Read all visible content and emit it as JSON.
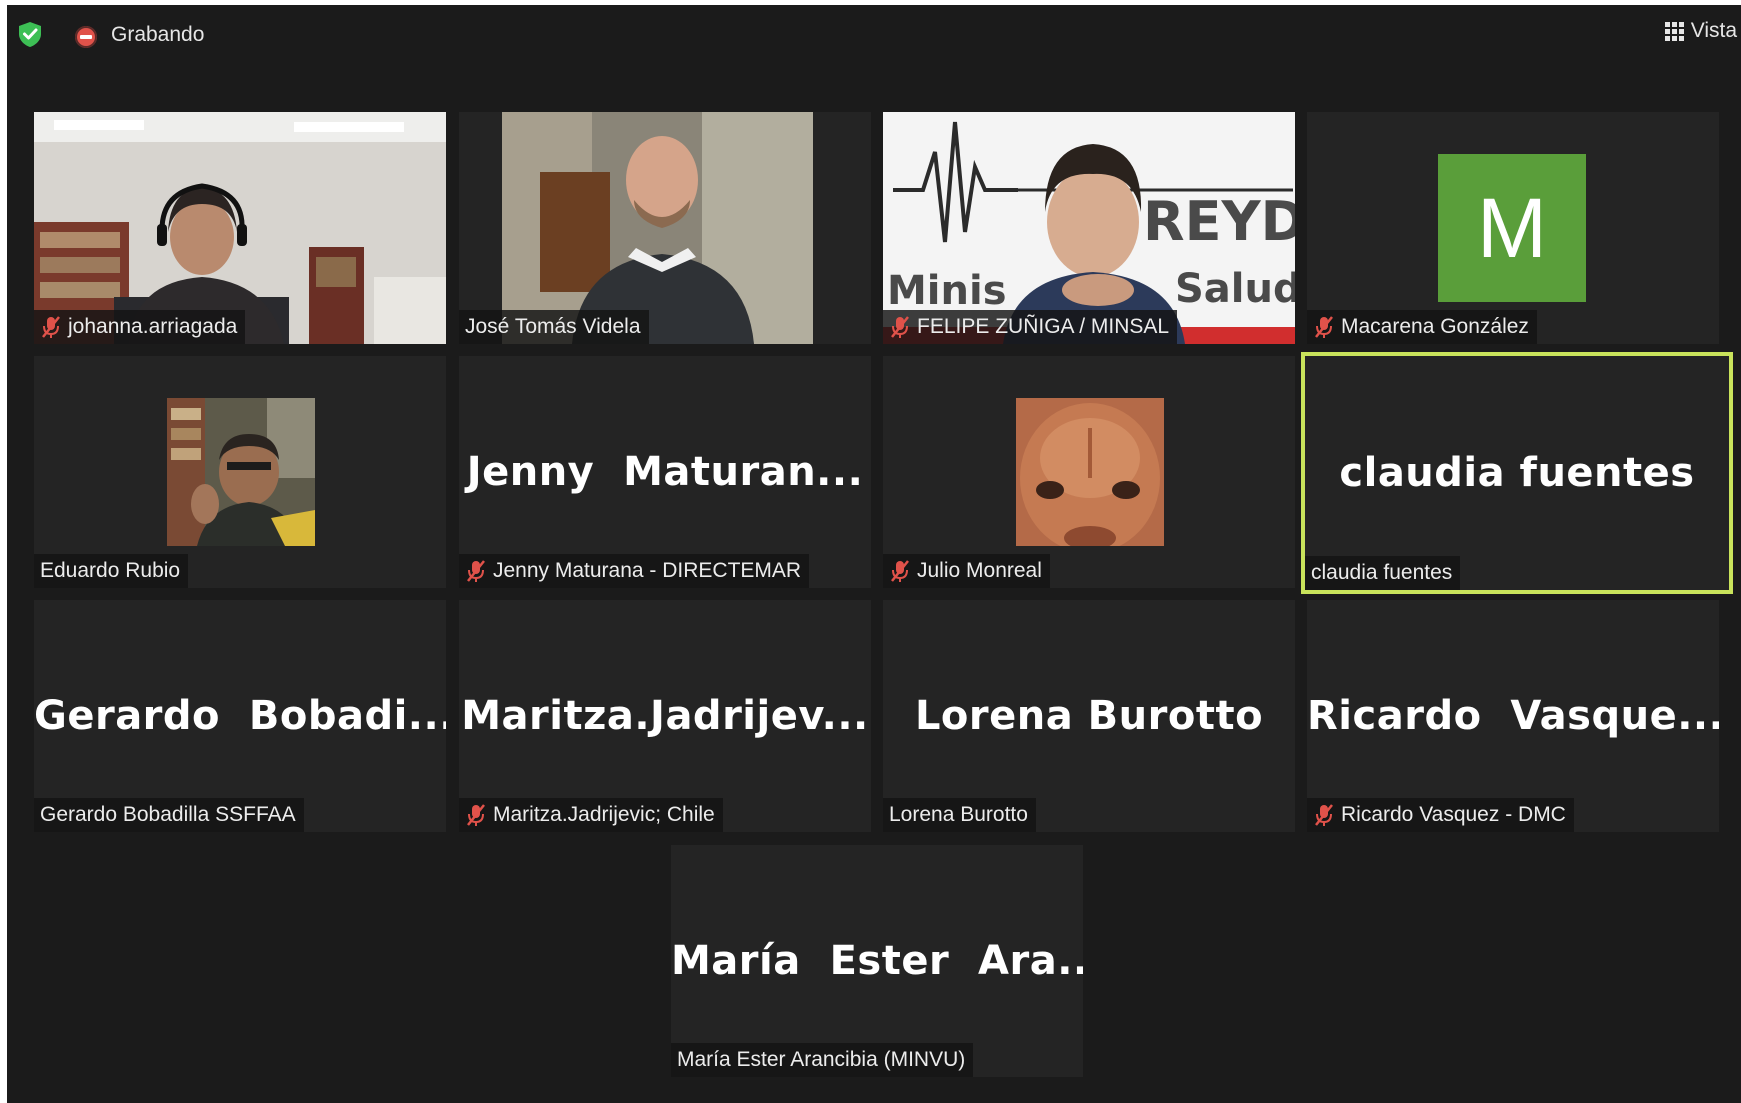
{
  "topbar": {
    "recording_label": "Grabando",
    "view_label": "Vista",
    "icons": [
      "shield-check-icon",
      "recording-icon",
      "grid-view-icon"
    ]
  },
  "colors": {
    "background": "#1b1b1b",
    "tile": "#242424",
    "active_speaker_border": "#c9e35b",
    "muted_mic": "#e0524a",
    "avatar": "#5a9e3a",
    "security_shield": "#3dbf55"
  },
  "participants": [
    {
      "display_name": "johanna.arriagada",
      "big_label": "",
      "muted": true,
      "video": true
    },
    {
      "display_name": "José Tomás Videla",
      "big_label": "",
      "muted": false,
      "video": true
    },
    {
      "display_name": "FELIPE ZUÑIGA / MINSAL",
      "big_label": "",
      "muted": true,
      "video": true
    },
    {
      "display_name": "Macarena González",
      "big_label": "M",
      "muted": true,
      "video": false
    },
    {
      "display_name": "Eduardo Rubio",
      "big_label": "",
      "muted": false,
      "video": true
    },
    {
      "display_name": "Jenny Maturana - DIRECTEMAR",
      "big_label": "Jenny  Maturan...",
      "muted": true,
      "video": false
    },
    {
      "display_name": "Julio Monreal",
      "big_label": "",
      "muted": true,
      "video": true
    },
    {
      "display_name": "claudia fuentes",
      "big_label": "claudia fuentes",
      "muted": false,
      "video": false,
      "active_speaker": true
    },
    {
      "display_name": "Gerardo Bobadilla SSFFAA",
      "big_label": "Gerardo  Bobadi...",
      "muted": false,
      "video": false
    },
    {
      "display_name": "Maritza.Jadrijevic; Chile",
      "big_label": "Maritza.Jadrijev...",
      "muted": true,
      "video": false
    },
    {
      "display_name": "Lorena Burotto",
      "big_label": "Lorena Burotto",
      "muted": false,
      "video": false
    },
    {
      "display_name": "Ricardo Vasquez - DMC",
      "big_label": "Ricardo  Vasque...",
      "muted": true,
      "video": false
    },
    {
      "display_name": "María Ester Arancibia (MINVU)",
      "big_label": "María  Ester  Ara...",
      "muted": false,
      "video": false
    }
  ],
  "video_backgrounds": {
    "felipe_sign_top": "REYD",
    "felipe_sign_bottom_left": "Minis",
    "felipe_sign_bottom_right": "Salud"
  }
}
